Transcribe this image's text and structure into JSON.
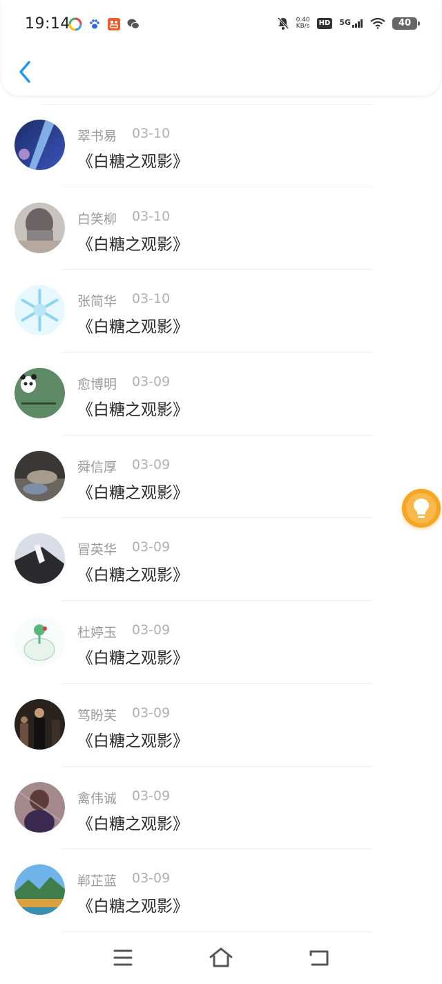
{
  "status_bar": {
    "time": "19:14",
    "net_speed_value": "0.40",
    "net_speed_unit": "KB/s",
    "hd": "HD",
    "network": "5G",
    "battery": "40"
  },
  "items": [
    {
      "name": "翠书易",
      "date": "03-10",
      "title": "《白糖之观影》"
    },
    {
      "name": "白笑柳",
      "date": "03-10",
      "title": "《白糖之观影》"
    },
    {
      "name": "张简华",
      "date": "03-10",
      "title": "《白糖之观影》"
    },
    {
      "name": "愈博明",
      "date": "03-09",
      "title": "《白糖之观影》"
    },
    {
      "name": "舜信厚",
      "date": "03-09",
      "title": "《白糖之观影》"
    },
    {
      "name": "冒英华",
      "date": "03-09",
      "title": "《白糖之观影》"
    },
    {
      "name": "杜婷玉",
      "date": "03-09",
      "title": "《白糖之观影》"
    },
    {
      "name": "笃盼芙",
      "date": "03-09",
      "title": "《白糖之观影》"
    },
    {
      "name": "禽伟诚",
      "date": "03-09",
      "title": "《白糖之观影》"
    },
    {
      "name": "郸芷蓝",
      "date": "03-09",
      "title": "《白糖之观影》"
    }
  ],
  "icons": {
    "back": "chevron-left-icon",
    "fab": "lightbulb-icon",
    "nav_menu": "menu-icon",
    "nav_home": "home-icon",
    "nav_back": "return-icon"
  },
  "colors": {
    "accent": "#2196F3",
    "fab": "#F5A623",
    "name_text": "#9A9A9A",
    "title_text": "#2A2A2A"
  }
}
